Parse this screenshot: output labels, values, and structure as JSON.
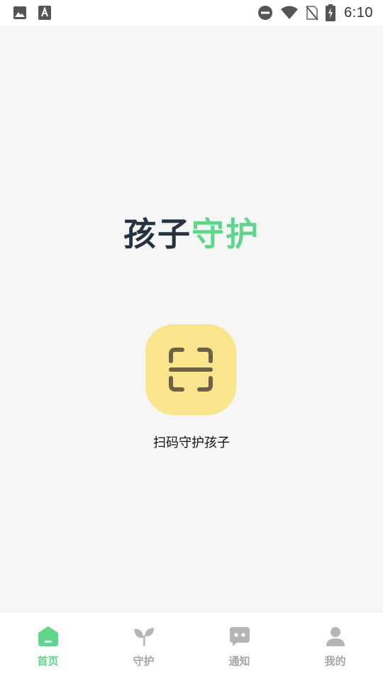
{
  "status_bar": {
    "time": "6:10",
    "icons": [
      "image-icon",
      "text-icon",
      "do-not-disturb-icon",
      "wifi-icon",
      "no-sim-icon",
      "battery-charging-icon"
    ]
  },
  "title": {
    "part1": "孩子",
    "part2": "守护"
  },
  "scan": {
    "icon": "scan-icon",
    "label": "扫码守护孩子"
  },
  "nav": {
    "items": [
      {
        "label": "首页",
        "icon": "home-icon",
        "active": true
      },
      {
        "label": "守护",
        "icon": "sprout-icon",
        "active": false
      },
      {
        "label": "通知",
        "icon": "message-icon",
        "active": false
      },
      {
        "label": "我的",
        "icon": "user-icon",
        "active": false
      }
    ]
  },
  "colors": {
    "accent": "#5fd68a",
    "title_dark": "#263240",
    "scan_bg": "#fbe58c",
    "nav_inactive": "#a5a5a5"
  }
}
